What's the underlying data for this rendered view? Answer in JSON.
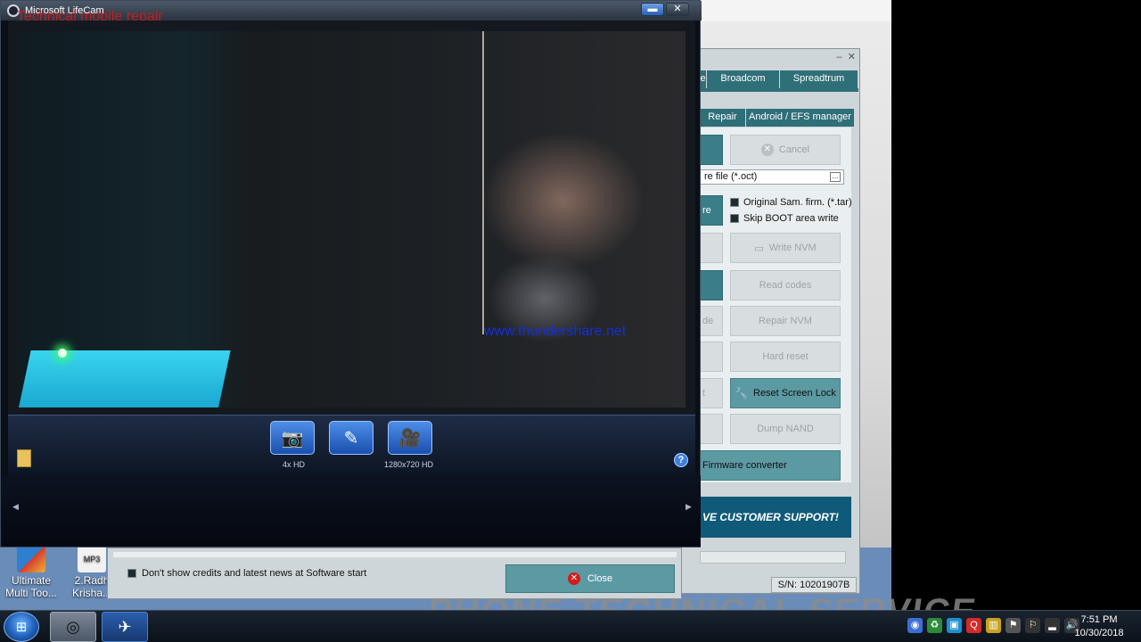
{
  "lifecam": {
    "title": "Microsoft LifeCam",
    "overlay_text": "Technical mobile repair",
    "watermark": "www.thundershare.net",
    "photo_label": "4x HD",
    "video_label": "1280x720 HD",
    "help": "?"
  },
  "tool": {
    "top_tabs": [
      "e",
      "Broadcom",
      "Spreadtrum"
    ],
    "sub_tabs": [
      "Repair",
      "Android / EFS manager"
    ],
    "cancel": "Cancel",
    "file_field": "re file (*.oct)",
    "partial_left": [
      "re",
      "de",
      "t"
    ],
    "options": [
      "Original Sam. firm. (*.tar)",
      "Skip BOOT area write"
    ],
    "buttons": [
      "Write NVM",
      "Read codes",
      "Repair NVM",
      "Hard reset",
      "Reset Screen Lock",
      "Dump NAND"
    ],
    "firmware_converter": "Firmware converter",
    "banner": "VE CUSTOMER SUPPORT!",
    "serial": "S/N: 10201907B"
  },
  "dialog": {
    "checkbox_label": "Don't show credits and latest news at Software start",
    "close": "Close"
  },
  "desktop": {
    "icons": [
      {
        "label": "Ultimate Multi Too...",
        "icon": "ultimate-multi-tool-icon"
      },
      {
        "label": "2.Radh Krisha...",
        "icon": "mp3-file-icon"
      }
    ],
    "wallpaper_text": "PHONE TECHNICAL SERVICE"
  },
  "taskbar": {
    "time": "7:51 PM",
    "date": "10/30/2018"
  }
}
